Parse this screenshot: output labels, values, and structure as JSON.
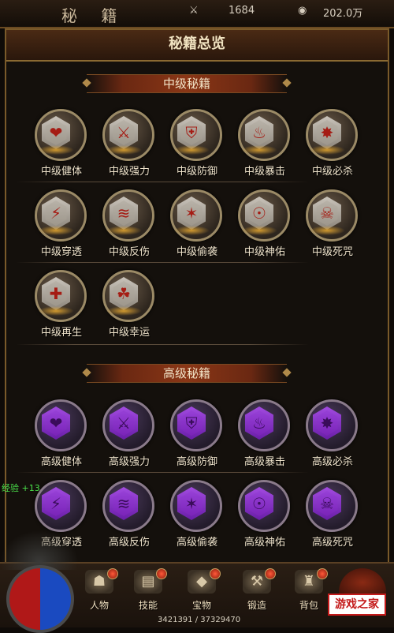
{
  "header": {
    "title": "秘 籍",
    "resource1": "1684",
    "resource2": "202.0万"
  },
  "panel": {
    "title": "秘籍总览"
  },
  "sections": [
    {
      "title": "中级秘籍",
      "tier": "mid",
      "skills": [
        {
          "label": "中级健体",
          "icon": "heart-rune-icon",
          "glyph": "❤"
        },
        {
          "label": "中级强力",
          "icon": "sword-rune-icon",
          "glyph": "⚔"
        },
        {
          "label": "中级防御",
          "icon": "shield-rune-icon",
          "glyph": "⛨"
        },
        {
          "label": "中级暴击",
          "icon": "crit-rune-icon",
          "glyph": "♨"
        },
        {
          "label": "中级必杀",
          "icon": "deathblow-rune-icon",
          "glyph": "✸"
        },
        {
          "label": "中级穿透",
          "icon": "pierce-rune-icon",
          "glyph": "⚡"
        },
        {
          "label": "中级反伤",
          "icon": "reflect-rune-icon",
          "glyph": "≋"
        },
        {
          "label": "中级偷袭",
          "icon": "ambush-rune-icon",
          "glyph": "✶"
        },
        {
          "label": "中级神佑",
          "icon": "blessing-rune-icon",
          "glyph": "☉"
        },
        {
          "label": "中级死咒",
          "icon": "curse-rune-icon",
          "glyph": "☠"
        },
        {
          "label": "中级再生",
          "icon": "regen-rune-icon",
          "glyph": "✚"
        },
        {
          "label": "中级幸运",
          "icon": "luck-rune-icon",
          "glyph": "☘"
        }
      ]
    },
    {
      "title": "高级秘籍",
      "tier": "high",
      "skills": [
        {
          "label": "高级健体",
          "icon": "heart-rune-icon",
          "glyph": "❤"
        },
        {
          "label": "高级强力",
          "icon": "sword-rune-icon",
          "glyph": "⚔"
        },
        {
          "label": "高级防御",
          "icon": "shield-rune-icon",
          "glyph": "⛨"
        },
        {
          "label": "高级暴击",
          "icon": "crit-rune-icon",
          "glyph": "♨"
        },
        {
          "label": "高级必杀",
          "icon": "deathblow-rune-icon",
          "glyph": "✸"
        },
        {
          "label": "高级穿透",
          "icon": "pierce-rune-icon",
          "glyph": "⚡"
        },
        {
          "label": "高级反伤",
          "icon": "reflect-rune-icon",
          "glyph": "≋"
        },
        {
          "label": "高级偷袭",
          "icon": "ambush-rune-icon",
          "glyph": "✶"
        },
        {
          "label": "高级神佑",
          "icon": "blessing-rune-icon",
          "glyph": "☉"
        },
        {
          "label": "高级死咒",
          "icon": "curse-rune-icon",
          "glyph": "☠"
        }
      ]
    }
  ],
  "exp_text": "经验 +13",
  "nav": [
    {
      "label": "人物",
      "icon": "character-icon",
      "glyph": "☗"
    },
    {
      "label": "技能",
      "icon": "skill-book-icon",
      "glyph": "▤"
    },
    {
      "label": "宝物",
      "icon": "treasure-icon",
      "glyph": "◆"
    },
    {
      "label": "锻造",
      "icon": "forge-anvil-icon",
      "glyph": "⚒"
    },
    {
      "label": "背包",
      "icon": "bag-icon",
      "glyph": "♜"
    }
  ],
  "exp_bar": "3421391 / 37329470",
  "watermark": "游戏之家",
  "colors": {
    "mid_gem": "#c9c3ba",
    "mid_symbol": "#a51c14",
    "high_gem": "#a24be0",
    "accent_gold": "#8a6a32"
  }
}
